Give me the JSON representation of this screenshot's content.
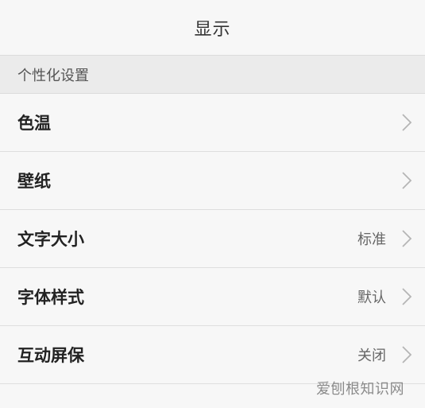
{
  "header": {
    "title": "显示"
  },
  "section": {
    "title": "个性化设置"
  },
  "items": [
    {
      "label": "色温",
      "value": ""
    },
    {
      "label": "壁纸",
      "value": ""
    },
    {
      "label": "文字大小",
      "value": "标准"
    },
    {
      "label": "字体样式",
      "value": "默认"
    },
    {
      "label": "互动屏保",
      "value": "关闭"
    }
  ],
  "watermark": {
    "text": "爱刨根知识网"
  },
  "icons": {
    "row_chevron": "chevron-right-icon"
  },
  "colors": {
    "background": "#f7f7f7",
    "section_header_bg": "#ebebeb",
    "divider": "#dedede",
    "label_text": "#222222",
    "value_text": "#666666",
    "chevron": "#b5b5b5"
  }
}
